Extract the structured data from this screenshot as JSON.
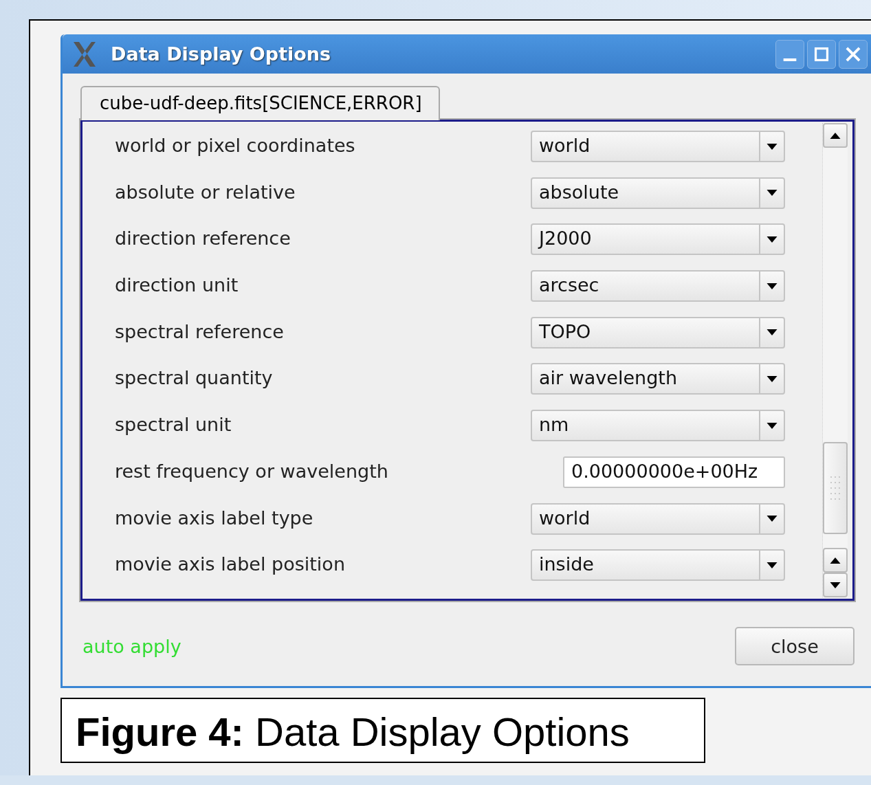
{
  "window": {
    "title": "Data Display Options"
  },
  "tabs": [
    {
      "label": "cube-udf-deep.fits[SCIENCE,ERROR]",
      "selected": true
    }
  ],
  "options": [
    {
      "label": "world or pixel coordinates",
      "kind": "select",
      "value": "world"
    },
    {
      "label": "absolute or relative",
      "kind": "select",
      "value": "absolute"
    },
    {
      "label": "direction reference",
      "kind": "select",
      "value": "J2000"
    },
    {
      "label": "direction unit",
      "kind": "select",
      "value": "arcsec"
    },
    {
      "label": "spectral reference",
      "kind": "select",
      "value": "TOPO"
    },
    {
      "label": "spectral quantity",
      "kind": "select",
      "value": "air wavelength"
    },
    {
      "label": "spectral unit",
      "kind": "select",
      "value": "nm"
    },
    {
      "label": "rest frequency or wavelength",
      "kind": "text",
      "value": "0.00000000e+00Hz"
    },
    {
      "label": "movie axis label type",
      "kind": "select",
      "value": "world"
    },
    {
      "label": "movie axis label position",
      "kind": "select",
      "value": "inside"
    }
  ],
  "status": "auto apply",
  "buttons": [
    "close"
  ],
  "caption": "**Figure 4:** Data Display Options"
}
